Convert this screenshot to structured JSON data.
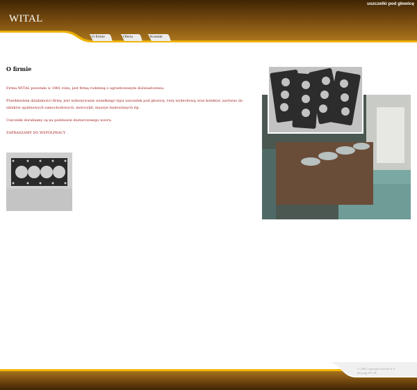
{
  "header": {
    "logo": "WITAL",
    "tagline": "uszczelki pod głowicę"
  },
  "nav": {
    "items": [
      {
        "label": "O firmie"
      },
      {
        "label": "Oferta"
      },
      {
        "label": "Kontakt"
      }
    ]
  },
  "main": {
    "title": "O firmie",
    "paragraphs": [
      "Firma WITAL powstała w 1981 roku, jest firmą rodzinną o ugruntowanym doświadczeniu.",
      "Przedmiotem działalności firmy, jest wykonywanie wszelkiego typu uszczelek pod głowicę, rurę wydechową oraz kolektor, zarówno do silników spalinowych samochodowych, motocykli, maszyn budowlanych itp.",
      "Uszczelki dorabiamy są na podstawie dostarczonego wzoru.",
      "ZAPRASZAMY DO WSPÓŁPRACY"
    ]
  },
  "footer": {
    "copyright_line1": "© 2005 copyright Intersik S.A.",
    "copyright_line2": "Hosting ITL.PL"
  },
  "colors": {
    "brown_dark": "#5a3608",
    "brown_light": "#b07a1e",
    "gold": "#f0b400",
    "body_text": "#a01818"
  }
}
